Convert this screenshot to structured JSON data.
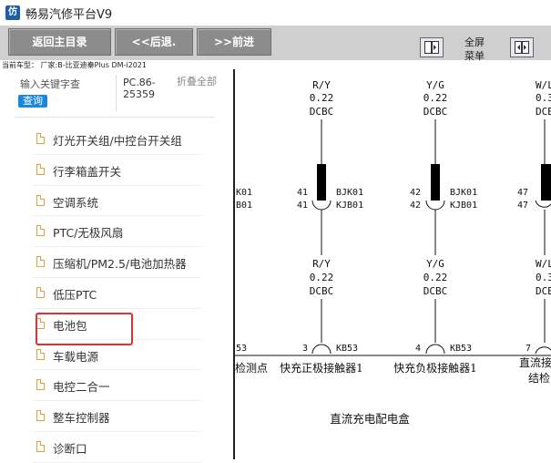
{
  "app": {
    "title": "畅易汽修平台V9",
    "icon_letter": "仿"
  },
  "toolbar": {
    "home_label": "返回主目录",
    "back_label": "<<后退.",
    "forward_label": ">>前进",
    "fullscreen_label_1": "全屏",
    "fullscreen_label_2": "菜单"
  },
  "car_info": "当前车型： 厂家:B-比亚迪秦Plus DM-i2021",
  "search": {
    "placeholder": "输入关键字查",
    "query_label": "查询"
  },
  "code": "PC.86-25359",
  "fold_all": "折叠全部",
  "tree": [
    "灯光开关组/中控台开关组",
    "行李箱盖开关",
    "空调系统",
    "PTC/无极风扇",
    "压缩机/PM2.5/电池加热器",
    "低压PTC",
    "电池包",
    "车载电源",
    "电控二合一",
    "整车控制器",
    "诊断口"
  ],
  "diagram": {
    "col1": {
      "wire_top": "R/Y",
      "gauge_top": "0.22",
      "type_top": "DCBC",
      "pin_a": "41",
      "pin_b": "41",
      "conn_a": "BJK01",
      "conn_b": "KJB01",
      "wire_bot": "R/Y",
      "gauge_bot": "0.22",
      "type_bot": "DCBC",
      "pin": "3",
      "conn": "KB53",
      "label": "快充正极接触器1"
    },
    "col2": {
      "wire_top": "Y/G",
      "gauge_top": "0.22",
      "type_top": "DCBC",
      "pin_a": "42",
      "pin_b": "42",
      "conn_a": "BJK01",
      "conn_b": "KJB01",
      "wire_bot": "Y/G",
      "gauge_bot": "0.22",
      "type_bot": "DCBC",
      "pin": "4",
      "conn": "KB53",
      "label": "快充负极接触器1"
    },
    "col3": {
      "wire_top": "W/L",
      "gauge_top": "0.3",
      "type_top": "DCBC",
      "pin_a": "47",
      "pin_b": "47",
      "wire_bot": "W/L",
      "gauge_bot": "0.3",
      "type_bot": "DCBC",
      "pin": "7",
      "label_1": "直流接",
      "label_2": "结检"
    },
    "left_conn_a": "K01",
    "left_conn_b": "B01",
    "left_pin": "53",
    "left_label": "检测点",
    "bottom_label": "直流充电配电盒"
  }
}
